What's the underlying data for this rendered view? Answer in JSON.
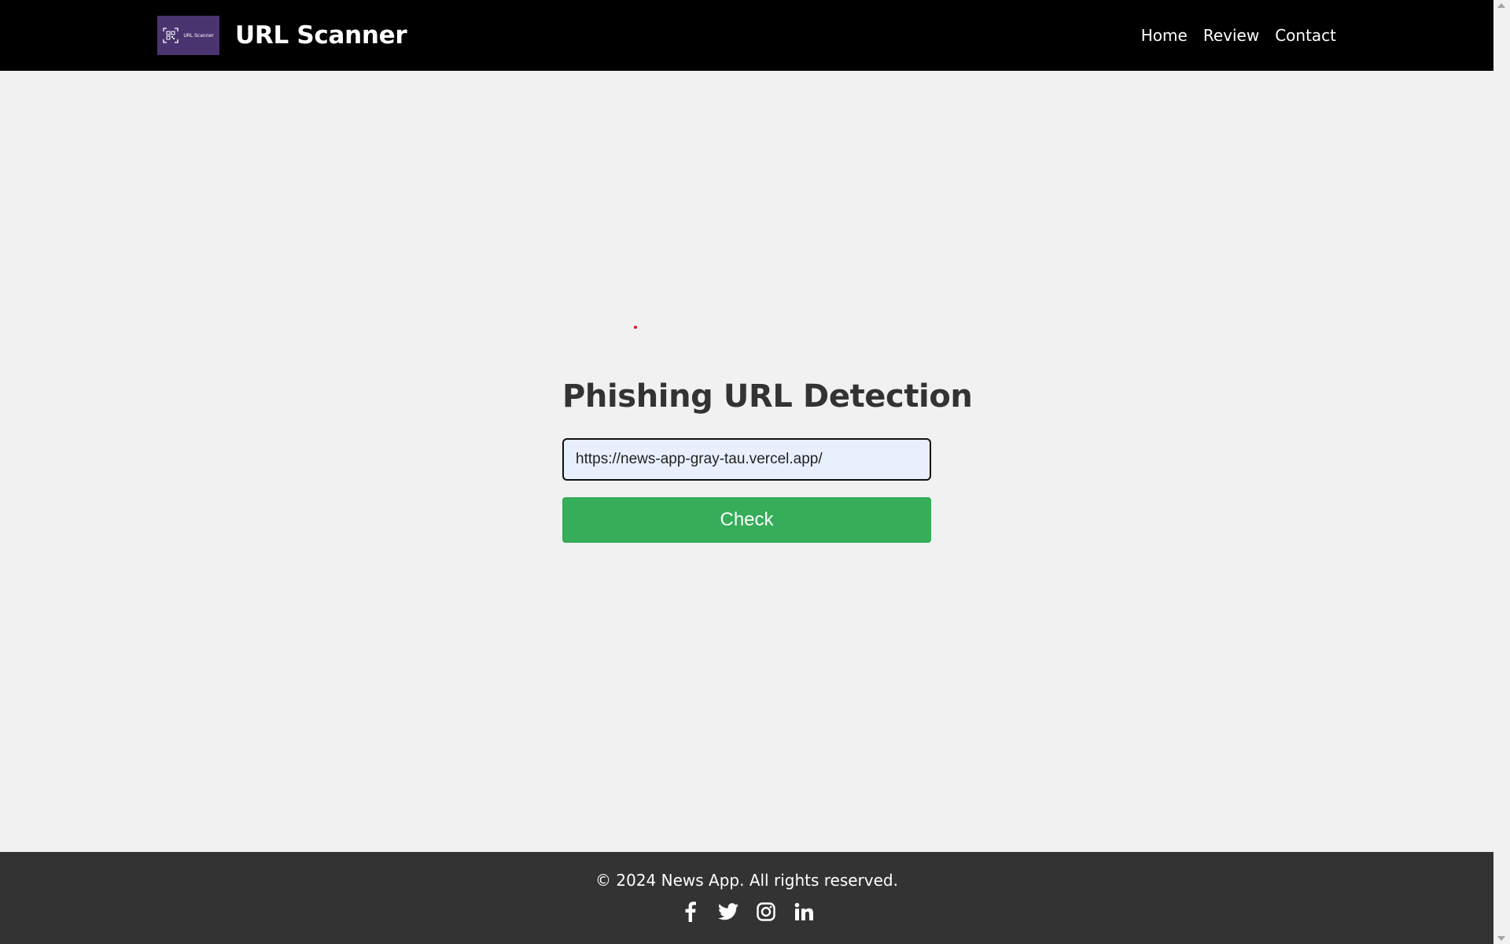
{
  "header": {
    "logo_text": "URL Scanner",
    "brand": "URL Scanner",
    "nav": [
      {
        "label": "Home"
      },
      {
        "label": "Review"
      },
      {
        "label": "Contact"
      }
    ]
  },
  "main": {
    "title": "Phishing URL Detection",
    "url_value": "https://news-app-gray-tau.vercel.app/",
    "check_label": "Check"
  },
  "footer": {
    "copyright": "© 2024 News App. All rights reserved.",
    "socials": [
      "facebook-icon",
      "twitter-icon",
      "instagram-icon",
      "linkedin-icon"
    ]
  },
  "colors": {
    "header_bg": "#000000",
    "logo_bg": "#4a3470",
    "button": "#35ad59",
    "footer_bg": "#333333",
    "page_bg": "#f1f1f1"
  }
}
